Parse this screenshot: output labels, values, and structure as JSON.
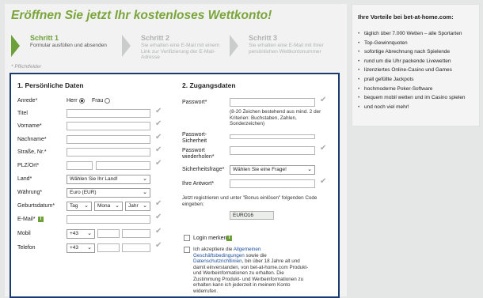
{
  "header": {
    "title": "Eröffnen Sie jetzt Ihr kostenloses Wettkonto!",
    "required_note": "* Pflichtfelder"
  },
  "steps": [
    {
      "title": "Schritt 1",
      "desc": "Formular ausfüllen und absenden",
      "active": true
    },
    {
      "title": "Schritt 2",
      "desc": "Sie erhalten eine E-Mail mit einem Link zur Verifizierung der E-Mail-Adresse",
      "active": false
    },
    {
      "title": "Schritt 3",
      "desc": "Sie erhalten eine E-Mail mit Ihrer persönlichen Wettkontonummer",
      "active": false
    }
  ],
  "personal": {
    "heading": "1. Persönliche Daten",
    "salutation_label": "Anrede*",
    "mr": "Herr",
    "mrs": "Frau",
    "title_label": "Titel",
    "firstname_label": "Vorname*",
    "lastname_label": "Nachname*",
    "street_label": "Straße, Nr.*",
    "zip_label": "PLZ/Ort*",
    "country_label": "Land*",
    "country_value": "Wählen Sie Ihr Land!",
    "currency_label": "Währung*",
    "currency_value": "Euro (EUR)",
    "birth_label": "Geburtsdatum*",
    "birth_day": "Tag",
    "birth_month": "Mona",
    "birth_year": "Jahr",
    "email_label": "E-Mail*",
    "mobile_label": "Mobil",
    "mobile_prefix": "+43",
    "phone_label": "Telefon",
    "phone_prefix": "+43"
  },
  "access": {
    "heading": "2. Zugangsdaten",
    "password_label": "Passwort*",
    "password_hint": "(8-20 Zeichen bestehend aus mind. 2 der Kriterien: Buchstaben, Zahlen, Sonderzeichen)",
    "strength_label": "Passwort-Sicherheit",
    "repeat_label": "Passwort wiederholen*",
    "question_label": "Sicherheitsfrage*",
    "question_value": "Wählen Sie eine Frage!",
    "answer_label": "Ihre Antwort*",
    "bonus_text": "Jetzt registrieren und unter \"Bonus einlösen\" folgenden Code eingeben:",
    "bonus_code": "EURO16",
    "remember_label": "Login merken",
    "terms_pre": "Ich akzeptiere die ",
    "terms_link1": "Allgemeinen Geschäftsbedingungen",
    "terms_mid": " sowie die ",
    "terms_link2": "Datenschutzrichtlinien",
    "terms_post": ", bin über 18 Jahre alt und damit einverstanden, von bet-at-home.com Produkt- und Werbeinformationen zu erhalten. Die Zustimmung Produkt- und Werbeinformationen zu erhalten kann ich jederzeit in meinem Konto widerrufen."
  },
  "sidebar": {
    "title": "Ihre Vorteile bei bet-at-home.com:",
    "items": [
      "täglich über 7.000 Wetten – alle Sportarten",
      "Top-Gewinnquoten",
      "sofortige Abrechnung nach Spielende",
      "rund um die Uhr packende Livewetten",
      "lizenziertes Online-Casino und Games",
      "prall gefüllte Jackpots",
      "hochmoderne Poker-Software",
      "bequem mobil wetten und im Casino spielen",
      "und noch viel mehr!"
    ]
  },
  "icons": {
    "check": "checkmark-icon",
    "info": "info-icon",
    "chevron": "chevron-down-icon",
    "bullet": "bullet-icon"
  },
  "colors": {
    "accent": "#7aa53a",
    "frame": "#1b3a6d",
    "link": "#1b4f9c"
  }
}
